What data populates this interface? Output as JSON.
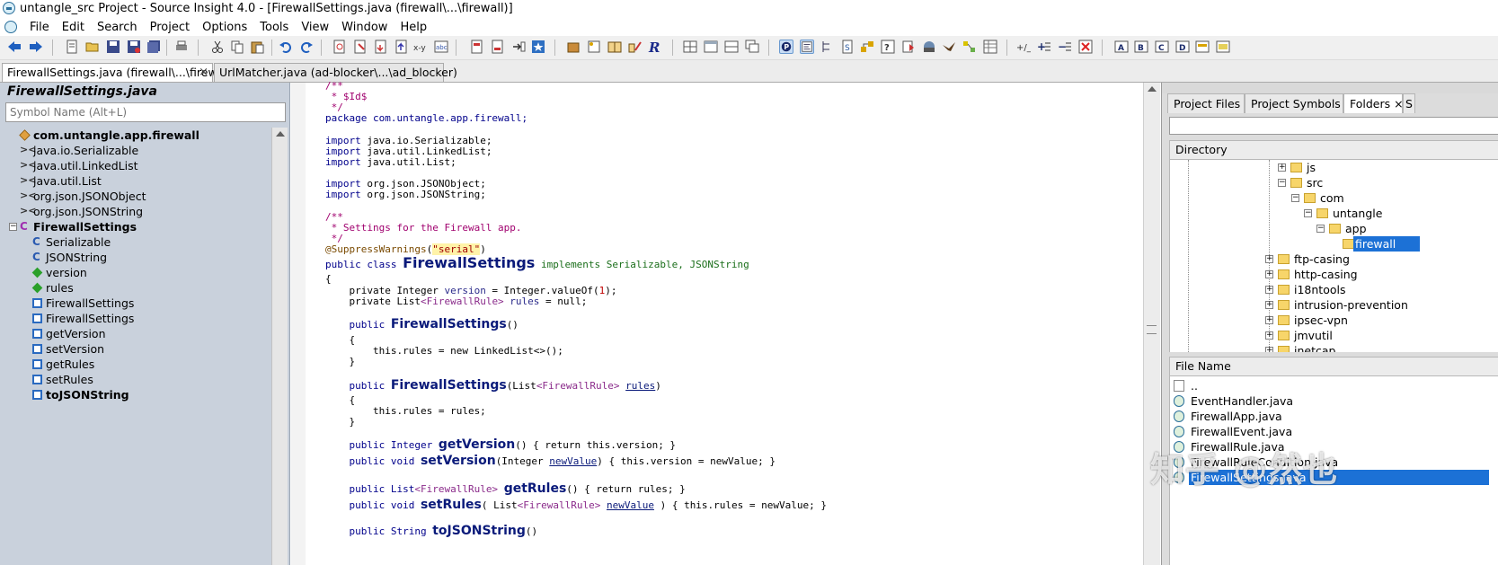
{
  "window": {
    "title": "untangle_src Project - Source Insight 4.0 - [FirewallSettings.java (firewall\\...\\firewall)]"
  },
  "menu": [
    "File",
    "Edit",
    "Search",
    "Project",
    "Options",
    "Tools",
    "View",
    "Window",
    "Help"
  ],
  "tabs": [
    {
      "label": "FirewallSettings.java (firewall\\...\\firewall)",
      "close": "×",
      "active": true
    },
    {
      "label": "UrlMatcher.java (ad-blocker\\...\\ad_blocker)",
      "active": false
    }
  ],
  "symbol_panel": {
    "title": "FirewallSettings.java",
    "search_placeholder": "Symbol Name (Alt+L)",
    "items": [
      {
        "label": "com.untangle.app.firewall",
        "icon": "package-icon",
        "bold": true
      },
      {
        "label": "java.io.Serializable",
        "icon": "import-icon"
      },
      {
        "label": "java.util.LinkedList",
        "icon": "import-icon"
      },
      {
        "label": "java.util.List",
        "icon": "import-icon"
      },
      {
        "label": "org.json.JSONObject",
        "icon": "import-icon"
      },
      {
        "label": "org.json.JSONString",
        "icon": "import-icon"
      },
      {
        "label": "FirewallSettings",
        "icon": "class-icon",
        "bold": true
      },
      {
        "label": "Serializable",
        "icon": "interface-icon"
      },
      {
        "label": "JSONString",
        "icon": "interface-icon"
      },
      {
        "label": "version",
        "icon": "field-icon"
      },
      {
        "label": "rules",
        "icon": "field-icon"
      },
      {
        "label": "FirewallSettings",
        "icon": "method-icon"
      },
      {
        "label": "FirewallSettings",
        "icon": "method-icon"
      },
      {
        "label": "getVersion",
        "icon": "method-icon"
      },
      {
        "label": "setVersion",
        "icon": "method-icon"
      },
      {
        "label": "getRules",
        "icon": "method-icon"
      },
      {
        "label": "setRules",
        "icon": "method-icon"
      },
      {
        "label": "toJSONString",
        "icon": "method-icon",
        "bold": true
      }
    ]
  },
  "code": {
    "c1": "/**",
    "c2": " * $Id$",
    "c3": " */",
    "pkg_kw": "package",
    "pkg_name": " com.untangle.app.firewall;",
    "imp_kw": "import",
    "imp1": " java.io.Serializable;",
    "imp2": " java.util.LinkedList;",
    "imp3": " java.util.List;",
    "imp4": " org.json.JSONObject;",
    "imp5": " org.json.JSONString;",
    "doc1": "/**",
    "doc2": " * Settings for the Firewall app.",
    "doc3": " */",
    "ann": "@SuppressWarnings",
    "ann_open": "(",
    "ann_str": "\"serial\"",
    "ann_close": ")",
    "class_kw": "public class ",
    "class_name": "FirewallSettings",
    "class_impl": " implements Serializable, JSONString",
    "brace_open": "{",
    "f1_a": "    private Integer ",
    "f1_b": "version",
    "f1_c": " = Integer.valueOf(",
    "f1_num": "1",
    "f1_d": ");",
    "f2_a": "    private List",
    "f2_gen": "<FirewallRule>",
    "f2_b": " rules",
    "f2_c": " = null;",
    "ctor1_kw": "    public ",
    "ctor1_name": "FirewallSettings",
    "ctor1_args": "()",
    "ctor1_open": "    {",
    "ctor1_body": "        this.rules = new LinkedList<>();",
    "ctor1_close": "    }",
    "ctor2_kw": "    public ",
    "ctor2_name": "FirewallSettings",
    "ctor2_a": "(List",
    "ctor2_gen": "<FirewallRule>",
    "ctor2_sp": " ",
    "ctor2_param": "rules",
    "ctor2_b": ")",
    "ctor2_open": "    {",
    "ctor2_body": "        this.rules = rules;",
    "ctor2_close": "    }",
    "gv_a": "    public Integer ",
    "gv_name": "getVersion",
    "gv_b": "() { return this.version; }",
    "sv_a": "    public void ",
    "sv_name": "setVersion",
    "sv_b": "(Integer ",
    "sv_param": "newValue",
    "sv_c": ") { this.version = newValue; }",
    "gr_a": "    public List",
    "gr_gen": "<FirewallRule>",
    "gr_sp": " ",
    "gr_name": "getRules",
    "gr_b": "() { return rules; }",
    "sr_a": "    public void ",
    "sr_name": "setRules",
    "sr_b": "( List",
    "sr_gen": "<FirewallRule>",
    "sr_sp": " ",
    "sr_param": "newValue",
    "sr_c": " ) { this.rules = newValue; }",
    "last_a": "    public String ",
    "last_name": "toJSONString",
    "last_b": "()"
  },
  "right_panel": {
    "tabs": [
      "Project Files",
      "Project Symbols",
      "Folders",
      "S"
    ],
    "folders_close": "×",
    "directory_header": "Directory",
    "file_name_header": "File Name",
    "directories": [
      {
        "label": "js",
        "toggle": "+"
      },
      {
        "label": "src",
        "toggle": "−"
      },
      {
        "label": "com",
        "toggle": "−"
      },
      {
        "label": "untangle",
        "toggle": "−"
      },
      {
        "label": "app",
        "toggle": "−"
      },
      {
        "label": "firewall",
        "selected": true
      },
      {
        "label": "ftp-casing",
        "toggle": "+"
      },
      {
        "label": "http-casing",
        "toggle": "+"
      },
      {
        "label": "i18ntools",
        "toggle": "+"
      },
      {
        "label": "intrusion-prevention",
        "toggle": "+"
      },
      {
        "label": "ipsec-vpn",
        "toggle": "+"
      },
      {
        "label": "jmvutil",
        "toggle": "+"
      },
      {
        "label": "jnetcap",
        "toggle": "+"
      }
    ],
    "files": [
      {
        "label": "..",
        "icon": "doc-icon"
      },
      {
        "label": "EventHandler.java",
        "icon": "java-file-icon"
      },
      {
        "label": "FirewallApp.java",
        "icon": "java-file-icon"
      },
      {
        "label": "FirewallEvent.java",
        "icon": "java-file-icon"
      },
      {
        "label": "FirewallRule.java",
        "icon": "java-file-icon"
      },
      {
        "label": "FirewallRuleCondition.java",
        "icon": "java-file-icon"
      },
      {
        "label": "FirewallSettings.java",
        "icon": "java-file-icon",
        "selected": true
      }
    ]
  },
  "watermark": "知乎 @然也",
  "colors": {
    "selection": "#1c71d6",
    "symbol_panel_bg": "#c9d1dc",
    "comment": "#a0006e",
    "keyword": "#00008b"
  }
}
